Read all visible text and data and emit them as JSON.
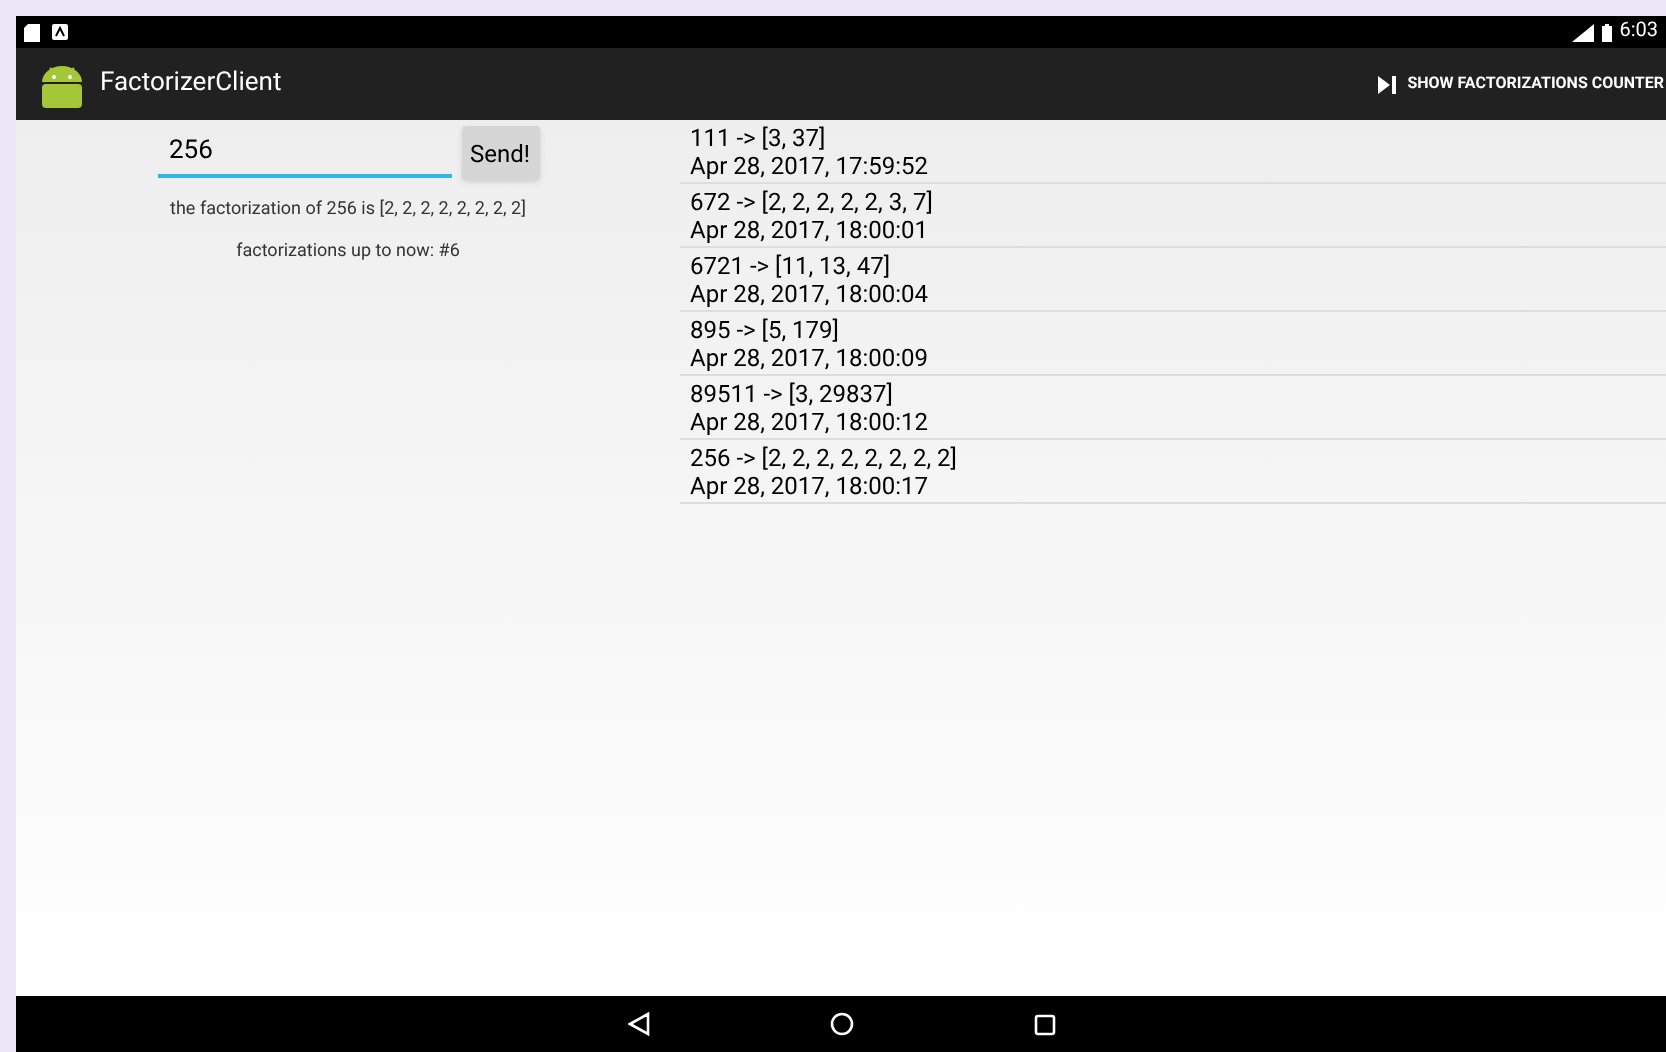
{
  "status_bar": {
    "time": "6:03"
  },
  "action_bar": {
    "title": "FactorizerClient",
    "action": "SHOW FACTORIZATIONS COUNTER"
  },
  "form": {
    "input_value": "256",
    "button": "Send!",
    "result": "the factorization of 256 is [2, 2, 2, 2, 2, 2, 2, 2]",
    "counter": "factorizations up to now: #6"
  },
  "history": [
    {
      "factorization": "111 -> [3, 37]",
      "time": "Apr 28, 2017, 17:59:52"
    },
    {
      "factorization": "672 -> [2, 2, 2, 2, 2, 3, 7]",
      "time": "Apr 28, 2017, 18:00:01"
    },
    {
      "factorization": "6721 -> [11, 13, 47]",
      "time": "Apr 28, 2017, 18:00:04"
    },
    {
      "factorization": "895 -> [5, 179]",
      "time": "Apr 28, 2017, 18:00:09"
    },
    {
      "factorization": "89511 -> [3, 29837]",
      "time": "Apr 28, 2017, 18:00:12"
    },
    {
      "factorization": "256 -> [2, 2, 2, 2, 2, 2, 2, 2]",
      "time": "Apr 28, 2017, 18:00:17"
    }
  ]
}
